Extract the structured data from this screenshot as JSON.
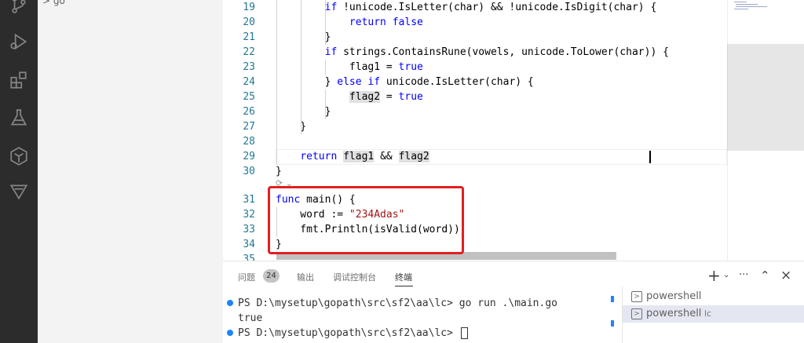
{
  "sidebar": {
    "folder_label": "> go"
  },
  "editor": {
    "lines": [
      {
        "n": "19",
        "tokens": [
          [
            "        ",
            ""
          ],
          [
            "if",
            "kw"
          ],
          [
            " !unicode.IsLetter(char) && !unicode.IsDigit(char) {",
            ""
          ]
        ]
      },
      {
        "n": "20",
        "tokens": [
          [
            "            ",
            ""
          ],
          [
            "return",
            "kw"
          ],
          [
            " ",
            ""
          ],
          [
            "false",
            "kw"
          ]
        ]
      },
      {
        "n": "21",
        "tokens": [
          [
            "        }",
            ""
          ]
        ]
      },
      {
        "n": "22",
        "tokens": [
          [
            "        ",
            ""
          ],
          [
            "if",
            "kw"
          ],
          [
            " strings.ContainsRune(vowels, unicode.ToLower(char)) {",
            ""
          ]
        ]
      },
      {
        "n": "23",
        "tokens": [
          [
            "            flag1 = ",
            ""
          ],
          [
            "true",
            "kw"
          ]
        ]
      },
      {
        "n": "24",
        "tokens": [
          [
            "        } ",
            ""
          ],
          [
            "else",
            "kw"
          ],
          [
            " ",
            ""
          ],
          [
            "if",
            "kw"
          ],
          [
            " unicode.IsLetter(char) {",
            ""
          ]
        ]
      },
      {
        "n": "25",
        "tokens": [
          [
            "            ",
            ""
          ],
          [
            "flag2",
            "hl"
          ],
          [
            " = ",
            ""
          ],
          [
            "true",
            "kw"
          ]
        ]
      },
      {
        "n": "26",
        "tokens": [
          [
            "        }",
            ""
          ]
        ]
      },
      {
        "n": "27",
        "tokens": [
          [
            "    }",
            ""
          ]
        ]
      },
      {
        "n": "28",
        "tokens": [
          [
            "",
            ""
          ]
        ]
      },
      {
        "n": "29",
        "tokens": [
          [
            "    ",
            ""
          ],
          [
            "return",
            "kw"
          ],
          [
            " ",
            ""
          ],
          [
            "flag1",
            "hl"
          ],
          [
            " && ",
            ""
          ],
          [
            "flag2",
            "hl"
          ]
        ]
      },
      {
        "n": "30",
        "tokens": [
          [
            "}",
            ""
          ]
        ]
      },
      {
        "n": "31",
        "tokens": [
          [
            "func",
            "kw"
          ],
          [
            " main() {",
            ""
          ]
        ]
      },
      {
        "n": "32",
        "tokens": [
          [
            "    word := ",
            ""
          ],
          [
            "\"234Adas\"",
            "str"
          ]
        ]
      },
      {
        "n": "33",
        "tokens": [
          [
            "    fmt.Println(isValid(word))",
            ""
          ]
        ]
      },
      {
        "n": "34",
        "tokens": [
          [
            "}",
            ""
          ]
        ]
      },
      {
        "n": "35",
        "tokens": [
          [
            "",
            ""
          ]
        ]
      }
    ],
    "codelens": "⟳ ⌄"
  },
  "panel": {
    "tabs": [
      {
        "label": "问题",
        "active": false
      },
      {
        "label": "输出",
        "active": false
      },
      {
        "label": "调试控制台",
        "active": false
      },
      {
        "label": "终端",
        "active": true
      }
    ],
    "problems_count": "24",
    "actions": {
      "add": "+",
      "dropdown": "⌄",
      "more": "···",
      "maximize": "⌃",
      "close": "×"
    },
    "terminal": {
      "line1": "PS D:\\mysetup\\gopath\\src\\sf2\\aa\\lc> go run .\\main.go",
      "line2": "true",
      "line3": "PS D:\\mysetup\\gopath\\src\\sf2\\aa\\lc> "
    },
    "terminals": [
      {
        "label": "powershell",
        "extra": "",
        "selected": false
      },
      {
        "label": "powershell",
        "extra": "lc",
        "selected": true
      }
    ]
  },
  "colors": {
    "highlight_box": "#e02020",
    "keyword": "#0000ff",
    "string": "#a31515",
    "line_number": "#237893"
  }
}
